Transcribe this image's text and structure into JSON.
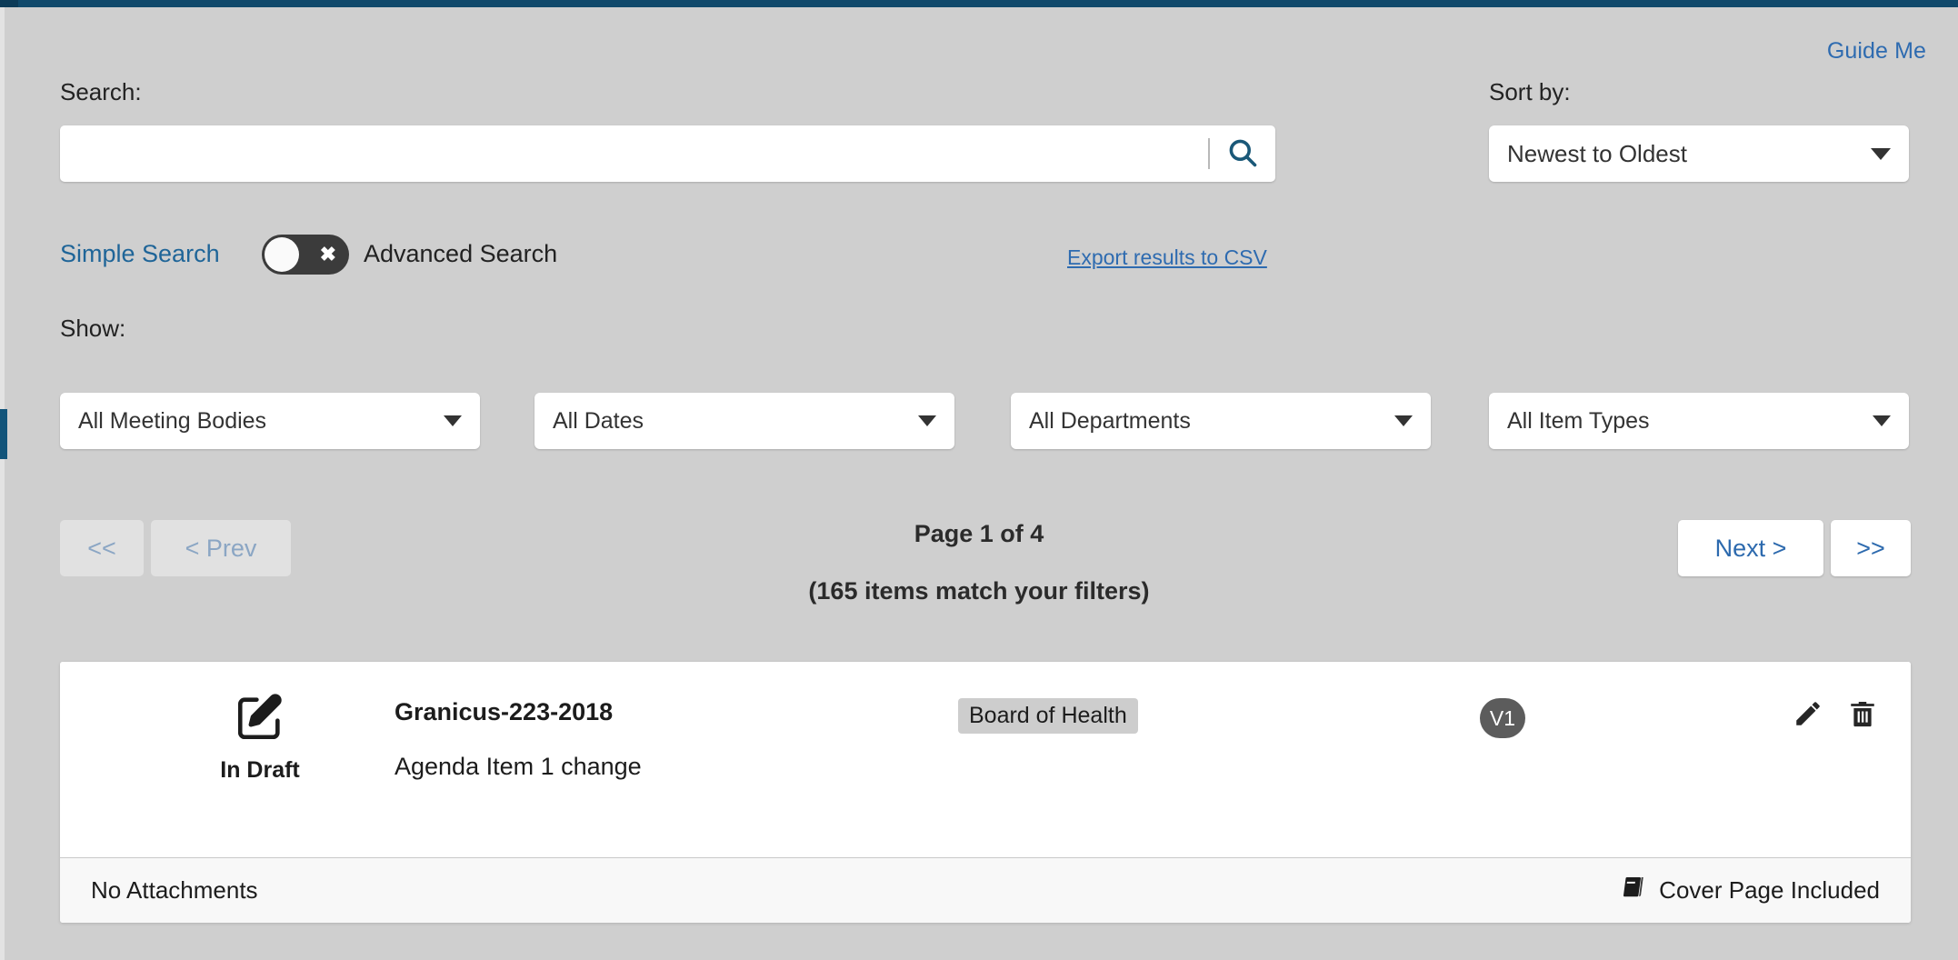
{
  "header": {
    "guide_me_label": "Guide Me",
    "search_label": "Search:",
    "sort_by_label": "Sort by:",
    "show_label": "Show:"
  },
  "search": {
    "value": "",
    "placeholder": "",
    "icon": "search-icon"
  },
  "sort": {
    "selected": "Newest to Oldest"
  },
  "search_mode": {
    "simple_label": "Simple Search",
    "advanced_label": "Advanced Search",
    "toggle_state": "simple",
    "toggle_mark": "✖"
  },
  "export": {
    "label": "Export results to CSV"
  },
  "filters": [
    {
      "name": "meeting-bodies",
      "selected": "All Meeting Bodies"
    },
    {
      "name": "dates",
      "selected": "All Dates"
    },
    {
      "name": "departments",
      "selected": "All Departments"
    },
    {
      "name": "item-types",
      "selected": "All Item Types"
    }
  ],
  "pagination": {
    "first_label": "<<",
    "prev_label": "< Prev",
    "next_label": "Next >",
    "last_label": ">>",
    "page_indicator": "Page 1 of 4",
    "result_count": "(165 items match your filters)",
    "current_page": 1,
    "total_pages": 4,
    "total_items": 165,
    "first_enabled": false,
    "prev_enabled": false,
    "next_enabled": true,
    "last_enabled": true
  },
  "results": [
    {
      "status": "In Draft",
      "status_icon": "draft-pencil-square-icon",
      "item_number": "Granicus-223-2018",
      "item_title": "Agenda Item 1 change",
      "meeting_body": "Board of Health",
      "version": "V1",
      "edit_icon": "pencil-icon",
      "delete_icon": "trash-icon",
      "attachments_label": "No Attachments",
      "cover_page_label": "Cover Page Included",
      "cover_page_icon": "book-icon"
    }
  ],
  "colors": {
    "page_background": "#cfcfcf",
    "top_bar": "#10496b",
    "link_blue": "#2e6bb0",
    "simple_search_blue": "#1f6598",
    "search_icon": "#1a5878",
    "badge_gray": "#5c5c5c",
    "pill_gray": "#cdcdcd",
    "disabled_text": "#8ba6c4"
  }
}
